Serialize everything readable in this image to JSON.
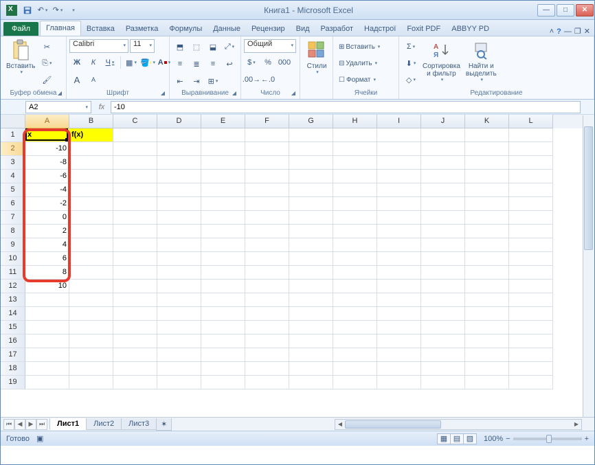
{
  "window": {
    "title": "Книга1 - Microsoft Excel"
  },
  "qat": {
    "save": "save",
    "undo": "undo",
    "redo": "redo"
  },
  "tabs": {
    "file": "Файл",
    "items": [
      "Главная",
      "Вставка",
      "Разметка",
      "Формулы",
      "Данные",
      "Рецензир",
      "Вид",
      "Разработ",
      "Надстрої",
      "Foxit PDF",
      "ABBYY PD"
    ],
    "active_index": 0
  },
  "ribbon": {
    "clipboard": {
      "label": "Буфер обмена",
      "paste": "Вставить"
    },
    "font": {
      "label": "Шрифт",
      "name": "Calibri",
      "size": "11",
      "bold": "Ж",
      "italic": "К",
      "underline": "Ч",
      "grow": "A",
      "shrink": "A"
    },
    "alignment": {
      "label": "Выравнивание"
    },
    "number": {
      "label": "Число",
      "format": "Общий"
    },
    "styles": {
      "label": "",
      "btn": "Стили"
    },
    "cells": {
      "label": "Ячейки",
      "insert": "Вставить",
      "delete": "Удалить",
      "format": "Формат"
    },
    "editing": {
      "label": "Редактирование",
      "sort": "Сортировка\nи фильтр",
      "find": "Найти и\nвыделить"
    }
  },
  "namebox": {
    "ref": "A2"
  },
  "formula": {
    "value": "-10",
    "fx": "fx"
  },
  "columns": [
    "A",
    "B",
    "C",
    "D",
    "E",
    "F",
    "G",
    "H",
    "I",
    "J",
    "K",
    "L"
  ],
  "rows": [
    1,
    2,
    3,
    4,
    5,
    6,
    7,
    8,
    9,
    10,
    11,
    12,
    13,
    14,
    15,
    16,
    17,
    18,
    19
  ],
  "headers": {
    "A1": "x",
    "B1": "f(x)"
  },
  "column_a": [
    "-10",
    "-8",
    "-6",
    "-4",
    "-2",
    "0",
    "2",
    "4",
    "6",
    "8",
    "10"
  ],
  "chart_data": {
    "type": "table",
    "columns": [
      "x",
      "f(x)"
    ],
    "x": [
      -10,
      -8,
      -6,
      -4,
      -2,
      0,
      2,
      4,
      6,
      8,
      10
    ]
  },
  "sheets": {
    "items": [
      "Лист1",
      "Лист2",
      "Лист3"
    ],
    "active": 0
  },
  "status": {
    "ready": "Готово",
    "zoom": "100%"
  }
}
